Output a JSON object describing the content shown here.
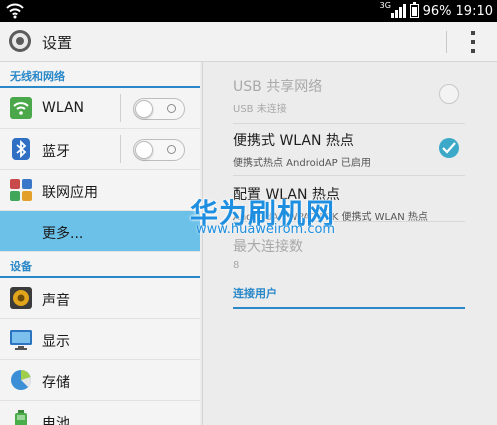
{
  "statusbar": {
    "network_type": "3G",
    "battery": "96%",
    "time": "19:10"
  },
  "actionbar": {
    "title": "设置"
  },
  "left": {
    "section_wireless": "无线和网络",
    "wlan_label": "WLAN",
    "bluetooth_label": "蓝牙",
    "connected_apps_label": "联网应用",
    "more_label": "更多...",
    "section_device": "设备",
    "sound_label": "声音",
    "display_label": "显示",
    "storage_label": "存储",
    "battery_label": "电池",
    "wlan_toggle": "off",
    "bluetooth_toggle": "off"
  },
  "right": {
    "usb_title": "USB 共享网络",
    "usb_sub": "USB 未连接",
    "hotspot_title": "便携式 WLAN 热点",
    "hotspot_sub": "便携式热点 AndroidAP 已启用",
    "hotspot_checked": true,
    "config_title": "配置 WLAN 热点",
    "config_sub": "AndroidAP WPA2 PSK 便携式 WLAN 热点",
    "max_title": "最大连接数",
    "max_value": "8",
    "connected_users": "连接用户"
  },
  "watermark": {
    "brand": "华为刷机网",
    "url": "www.huaweirom.com"
  },
  "colors": {
    "accent": "#2a88c8",
    "selected": "#6cc1e8",
    "check": "#3da9c9"
  }
}
